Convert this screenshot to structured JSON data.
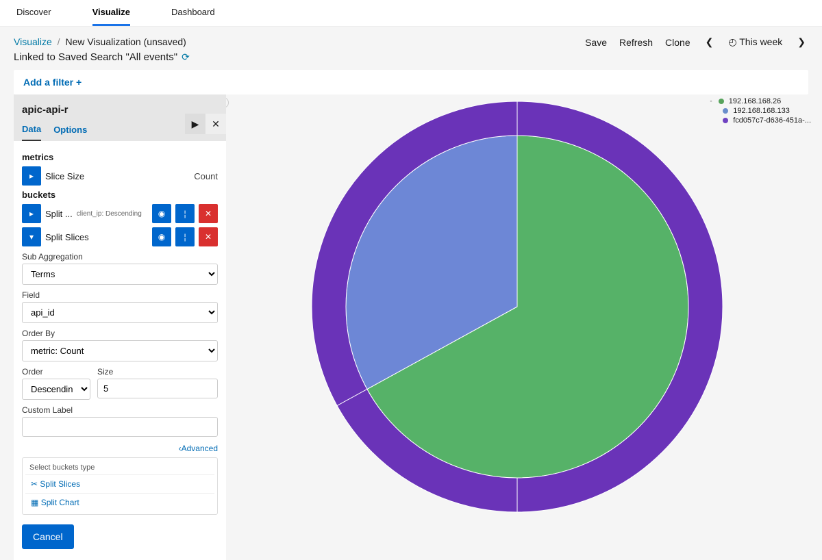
{
  "topnav": {
    "tabs": [
      "Discover",
      "Visualize",
      "Dashboard"
    ],
    "active": "Visualize"
  },
  "breadcrumb": {
    "root": "Visualize",
    "current": "New Visualization (unsaved)"
  },
  "linked_text": "Linked to Saved Search \"All events\"",
  "toolbar": {
    "save": "Save",
    "refresh": "Refresh",
    "clone": "Clone",
    "timerange": "This week"
  },
  "filter": {
    "add": "Add a filter +"
  },
  "panel": {
    "title": "apic-api-r",
    "tabs": {
      "data": "Data",
      "options": "Options"
    },
    "metrics_label": "metrics",
    "metric": {
      "name": "Slice Size",
      "agg": "Count"
    },
    "buckets_label": "buckets",
    "bucket1": {
      "name": "Split ...",
      "sub": "client_ip: Descending"
    },
    "bucket2": {
      "name": "Split Slices"
    },
    "subagg_label": "Sub Aggregation",
    "subagg_value": "Terms",
    "field_label": "Field",
    "field_value": "api_id",
    "orderby_label": "Order By",
    "orderby_value": "metric: Count",
    "order_label": "Order",
    "order_value": "Descending",
    "size_label": "Size",
    "size_value": "5",
    "customlabel_label": "Custom Label",
    "customlabel_value": "",
    "advanced": "Advanced",
    "select_type_label": "Select buckets type",
    "split_slices_opt": "Split Slices",
    "split_chart_opt": "Split Chart",
    "cancel": "Cancel"
  },
  "legend": {
    "items": [
      {
        "label": "192.168.168.26",
        "color": "#57a35c"
      },
      {
        "label": "192.168.168.133",
        "color": "#6a8ecb"
      },
      {
        "label": "fcd057c7-d636-451a-...",
        "color": "#6f42c1"
      }
    ]
  },
  "chart_data": {
    "type": "pie",
    "title": "",
    "rings": [
      {
        "name": "client_ip",
        "slices": [
          {
            "label": "192.168.168.26",
            "value": 67,
            "color": "#56b268"
          },
          {
            "label": "192.168.168.133",
            "value": 33,
            "color": "#6d87d6"
          }
        ]
      },
      {
        "name": "api_id",
        "slices": [
          {
            "label": "fcd057c7-d636-451a-...",
            "value": 100,
            "color": "#6a33b8"
          }
        ]
      }
    ]
  }
}
